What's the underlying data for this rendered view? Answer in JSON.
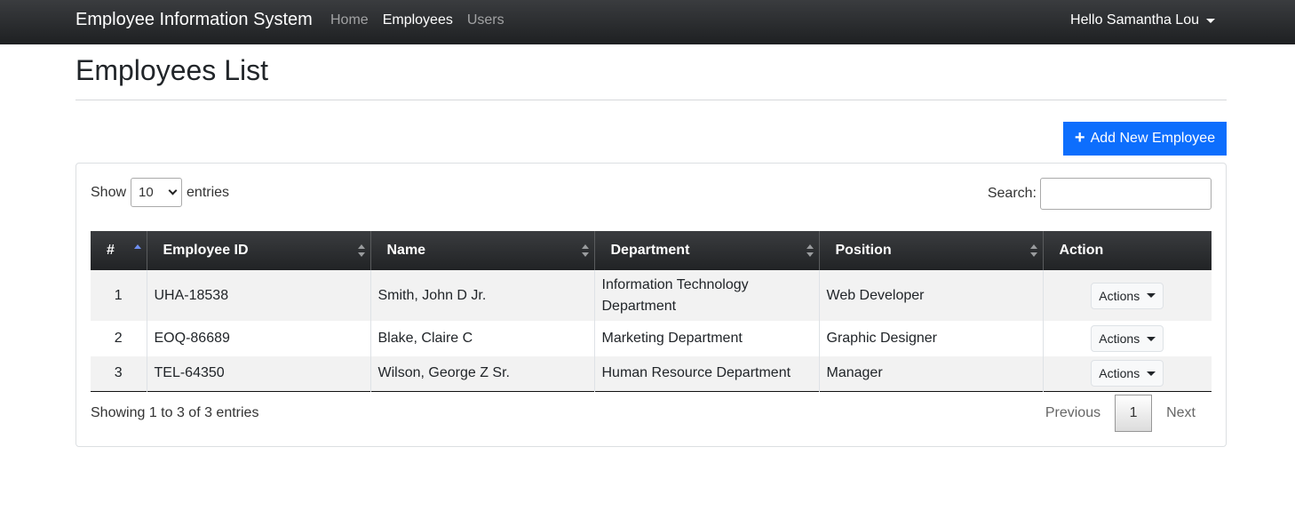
{
  "navbar": {
    "brand": "Employee Information System",
    "links": [
      "Home",
      "Employees",
      "Users"
    ],
    "active_link": "Employees",
    "user_greeting": "Hello Samantha Lou"
  },
  "page": {
    "title": "Employees List",
    "add_button_label": "Add New Employee"
  },
  "table_controls": {
    "show_label": "Show",
    "entries_label": "entries",
    "page_length": "10",
    "search_label": "Search:",
    "search_value": ""
  },
  "table": {
    "columns": [
      "#",
      "Employee ID",
      "Name",
      "Department",
      "Position",
      "Action"
    ],
    "rows": [
      {
        "num": "1",
        "employee_id": "UHA-18538",
        "name": "Smith, John D Jr.",
        "department": "Information Technology Department",
        "position": "Web Developer",
        "action": "Actions"
      },
      {
        "num": "2",
        "employee_id": "EOQ-86689",
        "name": "Blake, Claire C",
        "department": "Marketing Department",
        "position": "Graphic Designer",
        "action": "Actions"
      },
      {
        "num": "3",
        "employee_id": "TEL-64350",
        "name": "Wilson, George Z Sr.",
        "department": "Human Resource Department",
        "position": "Manager",
        "action": "Actions"
      }
    ]
  },
  "footer": {
    "info": "Showing 1 to 3 of 3 entries",
    "previous": "Previous",
    "current_page": "1",
    "next": "Next"
  },
  "colors": {
    "navbar_bg": "#2b2d30",
    "primary": "#0d6efd",
    "table_header_bg": "#2b2d30"
  },
  "icons": {
    "add_button": "plus-icon",
    "user_menu": "caret-down-icon",
    "sort": "sort-arrows-icon"
  }
}
